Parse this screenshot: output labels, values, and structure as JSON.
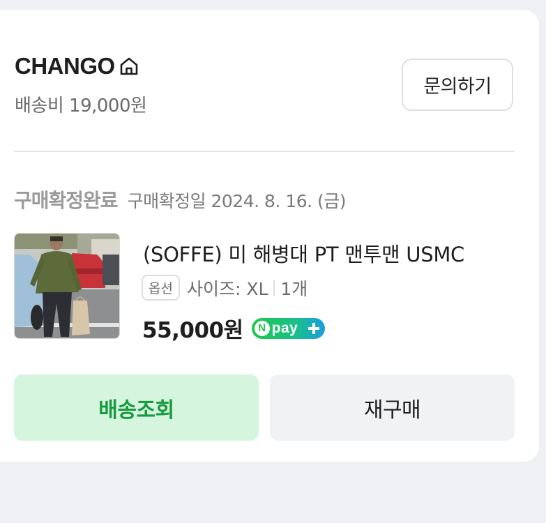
{
  "store": {
    "name": "CHANGO",
    "home_icon": "home-icon",
    "shipping_fee": "배송비 19,000원",
    "inquiry_label": "문의하기"
  },
  "order": {
    "status": "구매확정완료",
    "confirm_date": "구매확정일 2024. 8. 16. (금)"
  },
  "product": {
    "name": "(SOFFE) 미 해병대 PT 맨투맨 USMC",
    "option_badge": "옵션",
    "option_size": "사이즈: XL",
    "quantity": "1개",
    "price": "55,000원",
    "npay": {
      "n": "N",
      "text": "pay",
      "plus_icon": "plus-icon",
      "colors": [
        "#1ec84a",
        "#1a9ee0"
      ]
    }
  },
  "actions": {
    "track_label": "배송조회",
    "rebuy_label": "재구매"
  },
  "colors": {
    "track_bg": "#d5f5df",
    "track_text": "#189a3e",
    "rebuy_bg": "#f1f2f4"
  }
}
